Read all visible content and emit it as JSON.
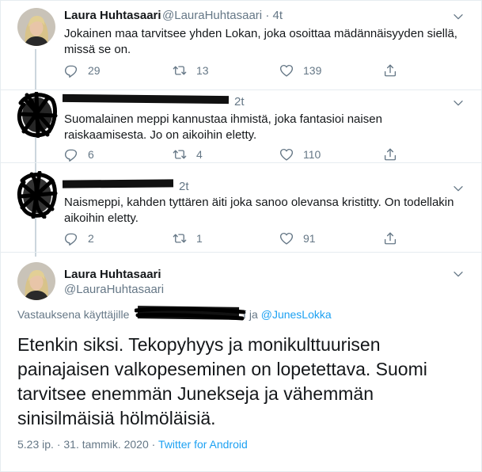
{
  "tweet1": {
    "name": "Laura Huhtasaari",
    "handle": "@LauraHuhtasaari",
    "sep": "·",
    "time": "4t",
    "text": "Jokainen maa tarvitsee yhden Lokan, joka osoittaa mädännäisyyden siellä, missä se on.",
    "replies": "29",
    "retweets": "13",
    "likes": "139"
  },
  "tweet2": {
    "time": "2t",
    "text": "Suomalainen meppi kannustaa ihmistä, joka fantasioi naisen raiskaamisesta. Jo on aikoihin eletty.",
    "replies": "6",
    "retweets": "4",
    "likes": "110"
  },
  "tweet3": {
    "time": "2t",
    "text": "Naismeppi, kahden tyttären äiti joka sanoo olevansa kristitty. On todellakin aikoihin eletty.",
    "replies": "2",
    "retweets": "1",
    "likes": "91"
  },
  "main_tweet": {
    "name": "Laura Huhtasaari",
    "handle": "@LauraHuhtasaari",
    "reply_prefix": "Vastauksena käyttäjille",
    "reply_mid": "f ja",
    "reply_handle": "@JunesLokka",
    "text": "Etenkin siksi. Tekopyhyys ja  monikulttuurisen painajaisen valkopeseminen on lopetettava. Suomi tarvitsee enemmän Junekseja ja vähemmän sinisilmäisiä hölmöläisiä.",
    "timestamp": "5.23 ip. · 31. tammik. 2020 ·",
    "source": "Twitter for Android"
  },
  "colors": {
    "accent": "#1da1f2",
    "secondary_text": "#657786",
    "primary_text": "#14171a",
    "divider": "#e6ecf0"
  },
  "icons": [
    "reply-icon",
    "retweet-icon",
    "like-icon",
    "share-icon",
    "chevron-down-icon"
  ]
}
